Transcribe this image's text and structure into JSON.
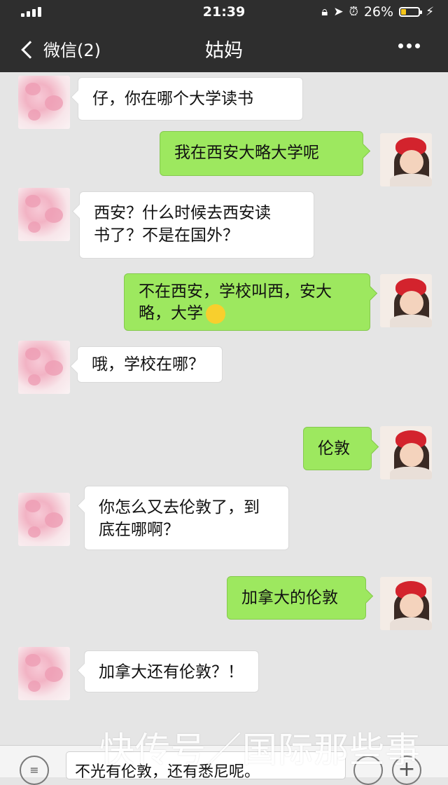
{
  "status_bar": {
    "time": "21:39",
    "battery": "26%",
    "battery_level": 0.26
  },
  "header": {
    "back_label": "微信(2)",
    "title": "姑妈"
  },
  "messages": [
    {
      "from": "other",
      "text": "仔，你在哪个大学读书"
    },
    {
      "from": "me",
      "text": "我在西安大略大学呢"
    },
    {
      "from": "other",
      "text": "西安？什么时候去西安读\n书了？不是在国外？"
    },
    {
      "from": "me",
      "text": "不在西安，学校叫西，安大\n略，大学",
      "emoji": "smile-emoji"
    },
    {
      "from": "other",
      "text": "哦，学校在哪？"
    },
    {
      "from": "me",
      "text": "伦敦"
    },
    {
      "from": "other",
      "text": "你怎么又去伦敦了，到\n底在哪啊？"
    },
    {
      "from": "me",
      "text": "加拿大的伦敦"
    },
    {
      "from": "other",
      "text": "加拿大还有伦敦？！"
    }
  ],
  "input": {
    "value": "不光有伦敦，还有悉尼呢。"
  },
  "watermark": "快传号／国际那些事",
  "colors": {
    "nav_bg": "#2e2e2e",
    "chat_bg": "#e5e5e5",
    "out_bubble": "#9de85f",
    "in_bubble": "#ffffff"
  }
}
